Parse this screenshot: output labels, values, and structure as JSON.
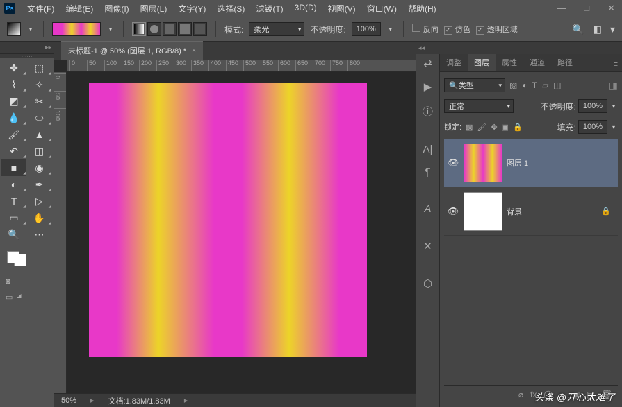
{
  "app": {
    "logo": "Ps"
  },
  "menu": [
    "文件(F)",
    "编辑(E)",
    "图像(I)",
    "图层(L)",
    "文字(Y)",
    "选择(S)",
    "滤镜(T)",
    "3D(D)",
    "视图(V)",
    "窗口(W)",
    "帮助(H)"
  ],
  "options": {
    "mode_label": "模式:",
    "mode_value": "柔光",
    "opacity_label": "不透明度:",
    "opacity_value": "100%",
    "chk_reverse": "反向",
    "chk_dither": "仿色",
    "chk_transparency": "透明区域"
  },
  "doc": {
    "tab_title": "未标题-1 @ 50% (图层 1, RGB/8) *",
    "zoom": "50%",
    "status": "文档:1.83M/1.83M"
  },
  "ruler_h": [
    "0",
    "50",
    "100",
    "150",
    "200",
    "250",
    "300",
    "350",
    "400",
    "450",
    "500",
    "550",
    "600",
    "650",
    "700",
    "750",
    "800"
  ],
  "ruler_v": [
    "0",
    "50",
    "100"
  ],
  "panels": {
    "tabs": [
      "调整",
      "图层",
      "属性",
      "通道",
      "路径"
    ],
    "filter_label": "类型",
    "blend_mode": "正常",
    "opacity_label": "不透明度:",
    "opacity_value": "100%",
    "lock_label": "锁定:",
    "fill_label": "填充:",
    "fill_value": "100%"
  },
  "layers": [
    {
      "name": "图层 1",
      "visible": true,
      "grad": true,
      "active": true,
      "locked": false
    },
    {
      "name": "背景",
      "visible": true,
      "grad": false,
      "active": false,
      "locked": true
    }
  ],
  "watermark": "头条 @开心太难了"
}
